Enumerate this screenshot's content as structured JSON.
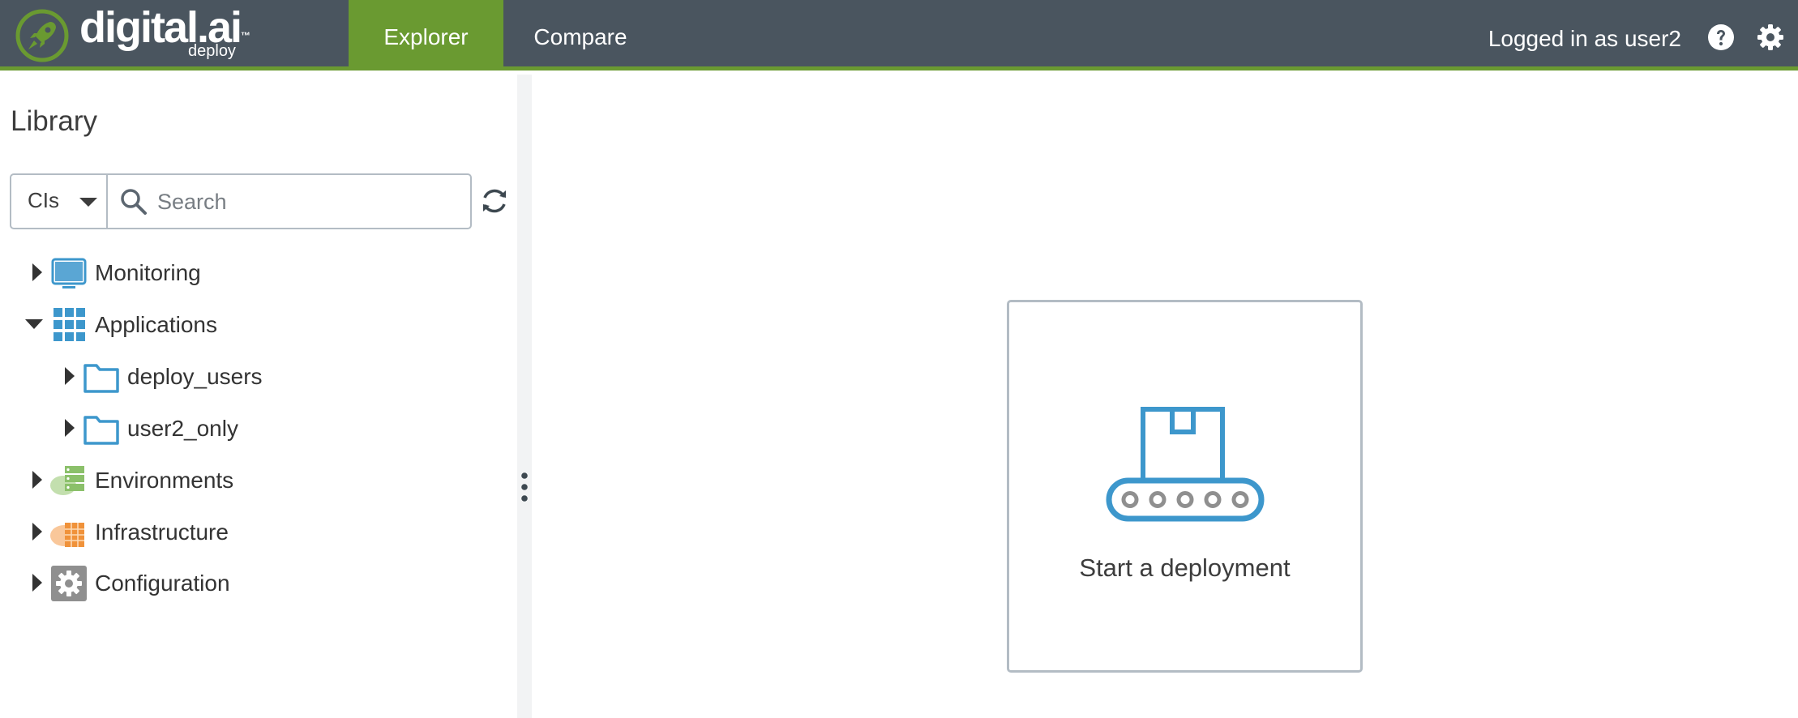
{
  "header": {
    "logo_text": "digital.ai",
    "logo_trademark": "™",
    "logo_subtext": "deploy",
    "tabs": [
      {
        "label": "Explorer",
        "active": true
      },
      {
        "label": "Compare",
        "active": false
      }
    ],
    "user_label": "Logged in as user2",
    "help_icon": "question-circle-icon",
    "settings_icon": "gear-icon"
  },
  "library": {
    "title": "Library",
    "filter_select": {
      "value": "CIs"
    },
    "search": {
      "placeholder": "Search",
      "value": ""
    },
    "refresh_icon": "refresh-icon",
    "tree": [
      {
        "label": "Monitoring",
        "icon": "monitor-icon",
        "expanded": false,
        "level": 0
      },
      {
        "label": "Applications",
        "icon": "grid-icon",
        "expanded": true,
        "level": 0
      },
      {
        "label": "deploy_users",
        "icon": "folder-icon",
        "expanded": false,
        "level": 1
      },
      {
        "label": "user2_only",
        "icon": "folder-icon",
        "expanded": false,
        "level": 1
      },
      {
        "label": "Environments",
        "icon": "environment-cloud-icon",
        "expanded": false,
        "level": 0
      },
      {
        "label": "Infrastructure",
        "icon": "infrastructure-cloud-icon",
        "expanded": false,
        "level": 0
      },
      {
        "label": "Configuration",
        "icon": "configuration-gear-icon",
        "expanded": false,
        "level": 0
      }
    ]
  },
  "main": {
    "start_card": {
      "label": "Start a deployment",
      "icon": "conveyor-box-icon"
    }
  },
  "colors": {
    "header_bg": "#4a555f",
    "accent_green": "#6a9a31",
    "icon_blue": "#3d97cc",
    "env_green": "#8bc06a",
    "infra_orange": "#f0923a",
    "config_gray": "#8f8f8f",
    "card_border": "#b3bcc4"
  }
}
